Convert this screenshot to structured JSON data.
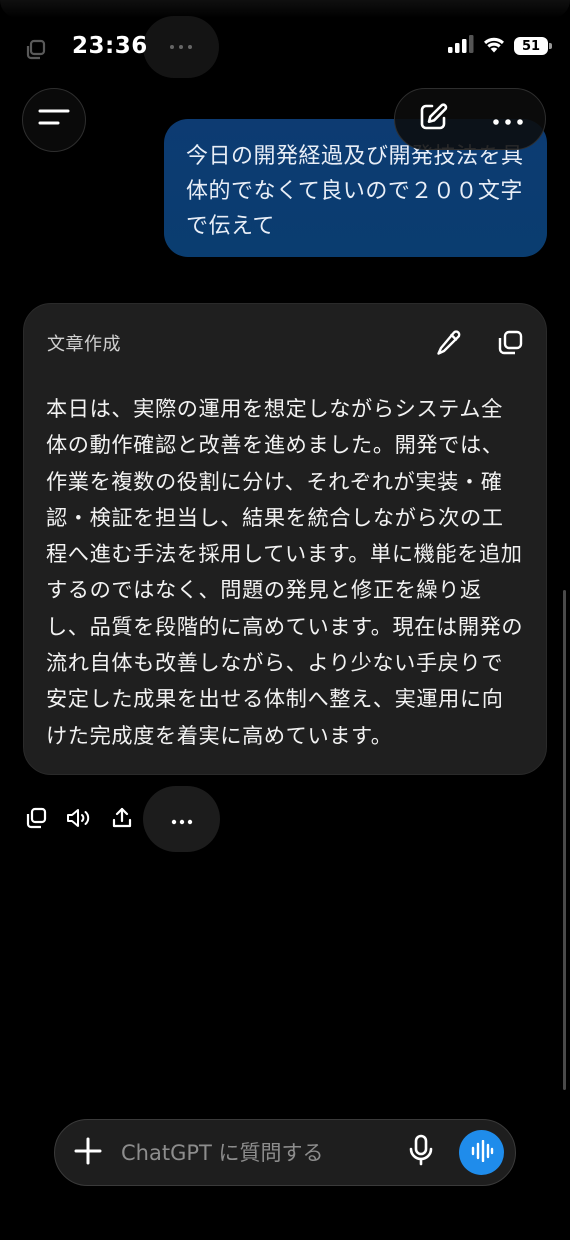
{
  "status_bar": {
    "time": "23:36",
    "battery": "51"
  },
  "header": {
    "menu_icon": "sidebar-menu-icon",
    "new_chat_icon": "compose-icon",
    "more_icon": "ellipsis-icon"
  },
  "user_message": {
    "text": "今日の開発経過及び開発技法を具体的でなくて良いので２００文字で伝えて"
  },
  "assistant_card": {
    "title": "文章作成",
    "body": "本日は、実際の運用を想定しながらシステム全体の動作確認と改善を進めました。開発では、作業を複数の役割に分け、それぞれが実装・確認・検証を担当し、結果を統合しながら次の工程へ進む手法を採用しています。単に機能を追加するのではなく、問題の発見と修正を繰り返し、品質を段階的に高めています。現在は開発の流れ自体も改善しながら、より少ない手戻りで安定した成果を出せる体制へ整え、実運用に向けた完成度を着実に高めています。"
  },
  "actions": {
    "copy_icon": "copy-icon",
    "read_aloud_icon": "speaker-icon",
    "share_icon": "share-icon",
    "more_icon": "ellipsis-icon"
  },
  "composer": {
    "placeholder": "ChatGPT に質問する",
    "accent_color": "#1f8ceb"
  }
}
